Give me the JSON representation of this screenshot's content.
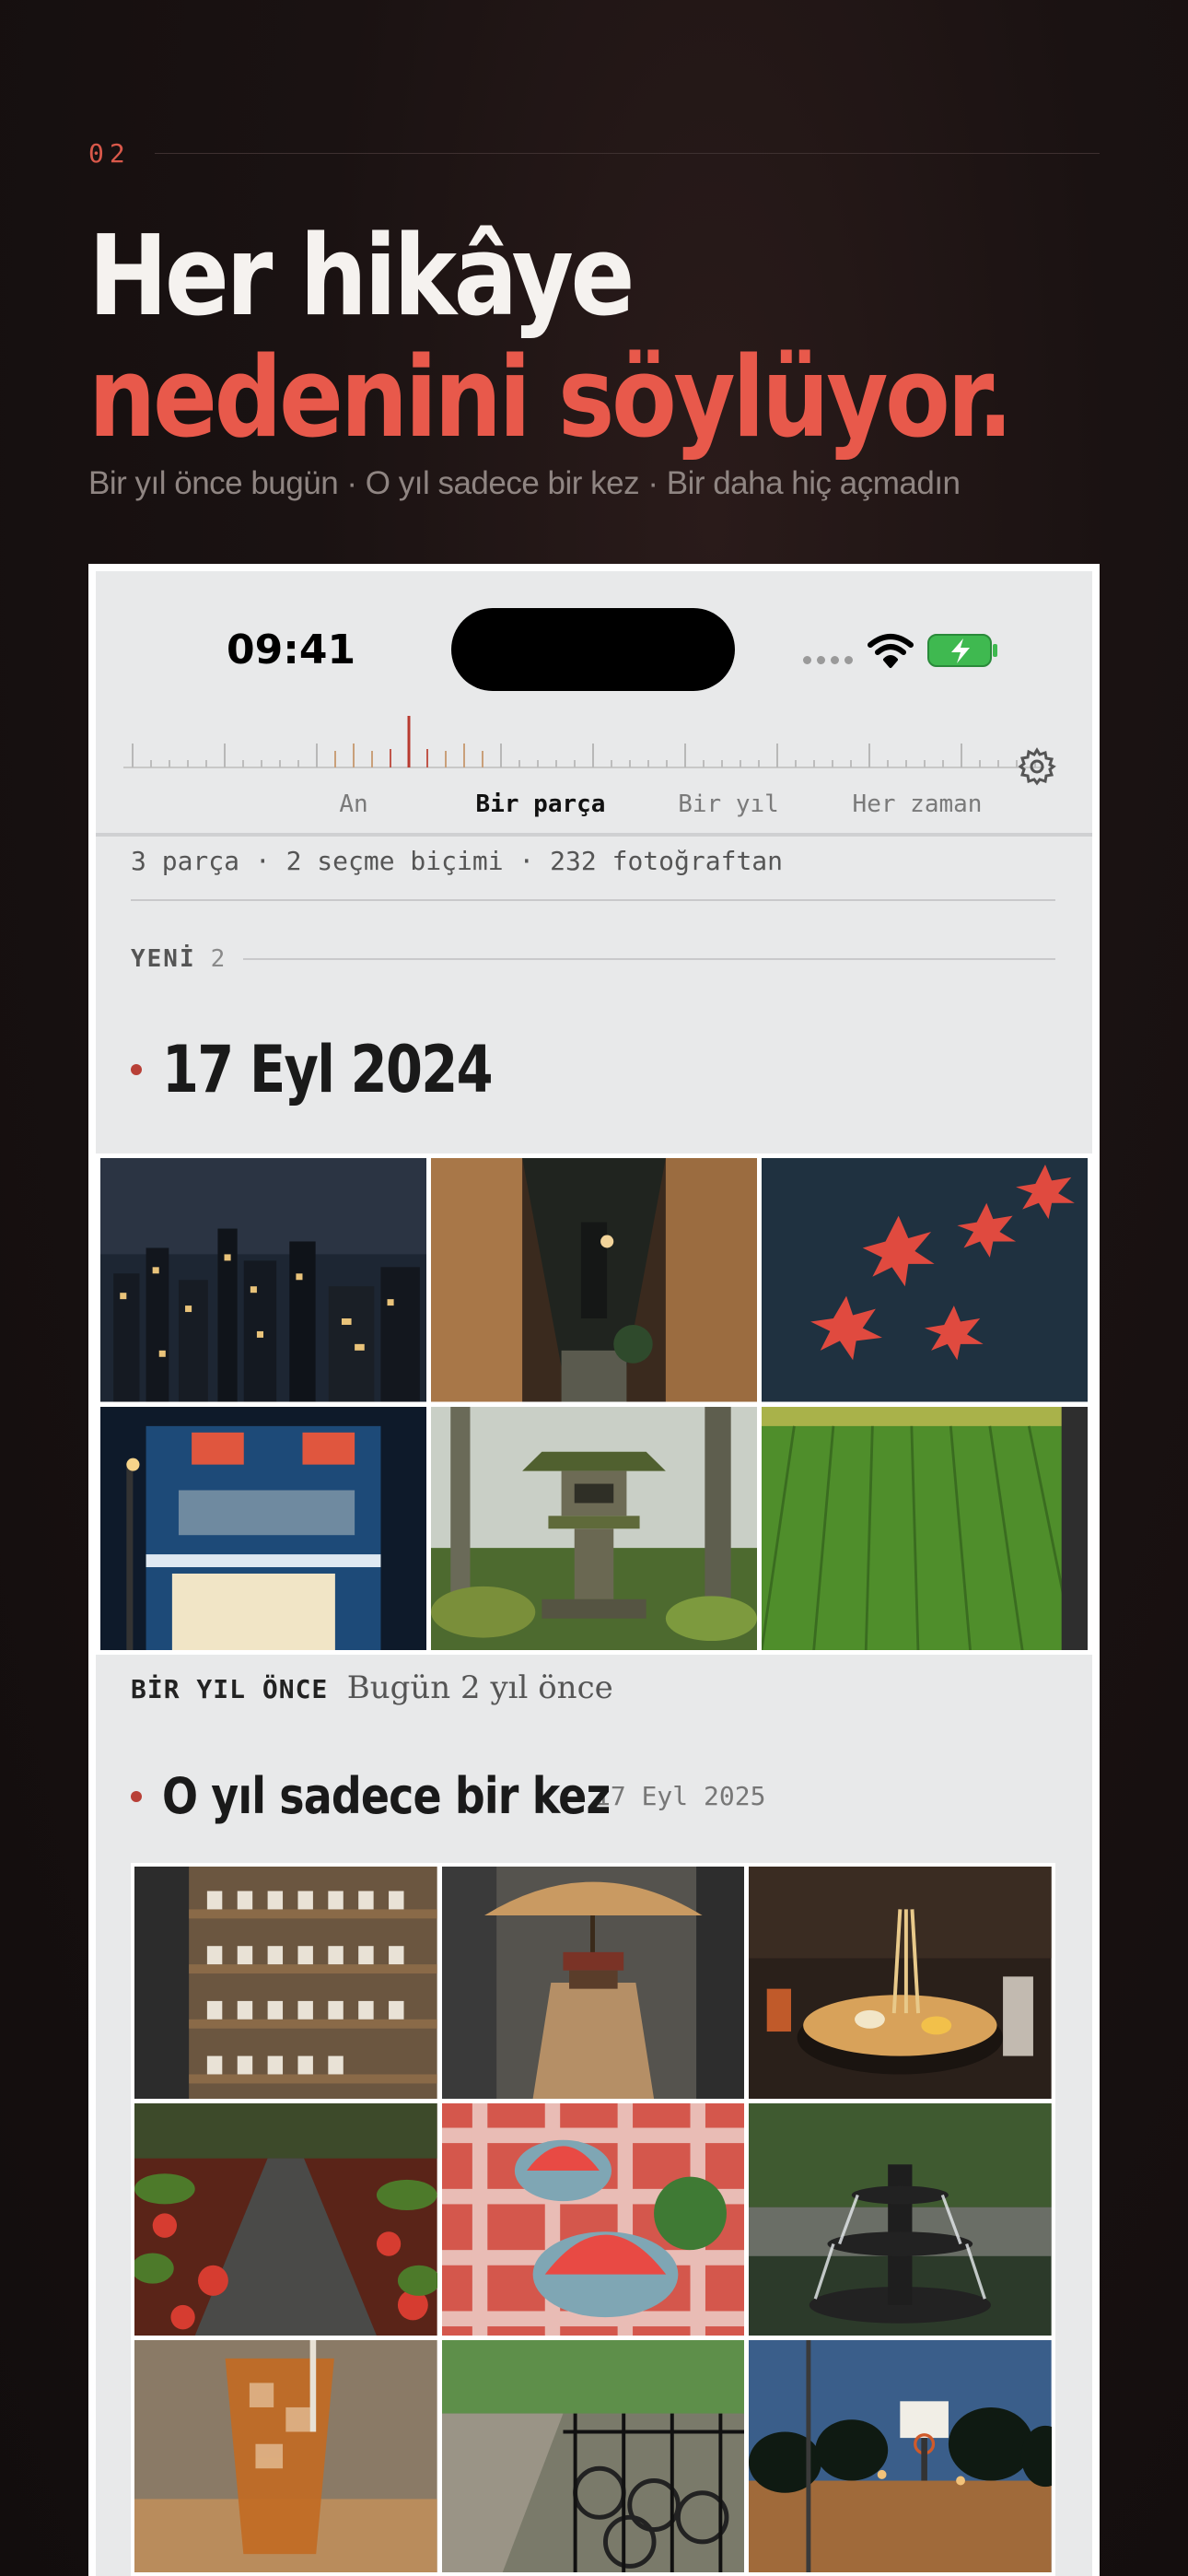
{
  "kicker": {
    "number": "02"
  },
  "headline": {
    "line1": "Her hikâye",
    "line2": "nedenini söylüyor."
  },
  "subline": "Bir yıl önce bugün · O yıl sadece bir kez · Bir daha hiç açmadın",
  "status_bar": {
    "time": "09:41",
    "icons": [
      "signal-dots-icon",
      "wifi-icon",
      "battery-charging-icon"
    ]
  },
  "segments": [
    {
      "label": "An",
      "active": false
    },
    {
      "label": "Bir parça",
      "active": true
    },
    {
      "label": "Bir yıl",
      "active": false
    },
    {
      "label": "Her zaman",
      "active": false
    }
  ],
  "settings_icon": "gear-icon",
  "summary": "3 parça · 2 seçme biçimi · 232 fotoğraftan",
  "section_new": {
    "label": "YENİ",
    "count": "2"
  },
  "group1": {
    "date": "17 Eyl 2024",
    "photos": [
      "night-city-skyline",
      "narrow-alley-lanterns",
      "red-maple-leaves-water",
      "corner-shop-night",
      "mossy-stone-lantern",
      "green-rice-field"
    ]
  },
  "once_label": "BİR YIL ÖNCE",
  "once_text": "Bugün 2 yıl önce",
  "group2": {
    "title": "O yıl sadece bir kez",
    "date": "17 Eyl 2025",
    "photos": [
      "cup-shelf-shop",
      "paper-umbrella-street",
      "ramen-bowl",
      "maple-stone-path",
      "watermelon-picnic",
      "park-fountain",
      "iced-tea-glass",
      "bicycles-railing",
      "basketball-court-dusk"
    ]
  },
  "colors": {
    "accent": "#e8594b",
    "background": "#120d0d",
    "screen_bg": "#e8e9ea"
  }
}
